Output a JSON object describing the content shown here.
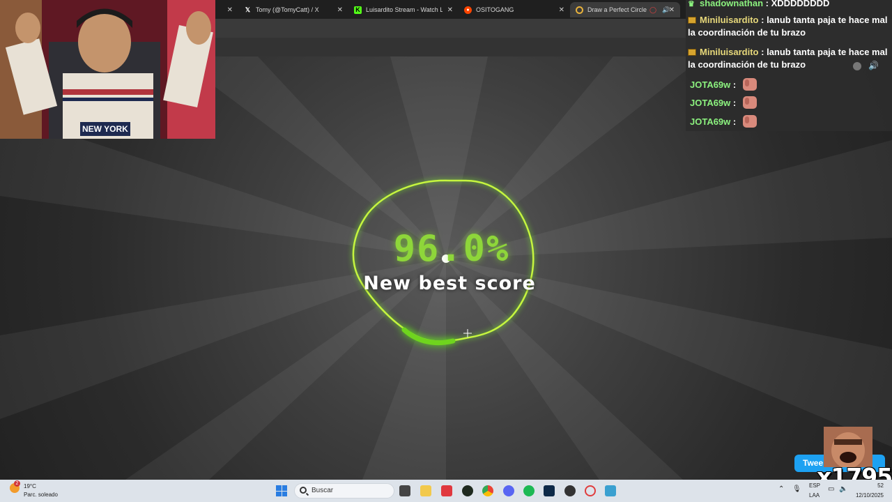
{
  "tabs": [
    {
      "label": "Tomy (@TomyCatt) / X",
      "icon": "x-icon"
    },
    {
      "label": "Luisardito Stream - Watch Live",
      "icon": "kick-icon"
    },
    {
      "label": "OSITOGANG",
      "icon": "reddit-icon"
    },
    {
      "label": "Draw a Perfect Circle",
      "icon": "circle-icon"
    }
  ],
  "game": {
    "score": "96.0%",
    "subtitle": "New best score",
    "accent_color": "#8ed63a"
  },
  "chat": [
    {
      "user": "shadownathan",
      "message": "XDDDDDDDD",
      "badge": "crown-icon"
    },
    {
      "user": "Miniluisardito",
      "message": "lanub tanta paja te hace mal la coordinación de tu brazo",
      "badge": "sub-badge-icon"
    },
    {
      "user": "Miniluisardito",
      "message": "lanub tanta paja te hace mal la coordinación de tu brazo",
      "badge": "sub-badge-icon"
    },
    {
      "user": "JOTA69w",
      "message": "",
      "emote": "thumb-emote"
    },
    {
      "user": "JOTA69w",
      "message": "",
      "emote": "thumb-emote"
    },
    {
      "user": "JOTA69w",
      "message": "",
      "emote": "thumb-emote"
    }
  ],
  "overlay": {
    "tweet_label": "Twee",
    "count": "x1795"
  },
  "webcam": {
    "shirt_text": "NEW YORK"
  },
  "taskbar": {
    "temperature": "19°C",
    "weather_desc": "Parc. soleado",
    "weather_badge": "2",
    "search_placeholder": "Buscar",
    "lang_top": "ESP",
    "lang_bottom": "LAA",
    "time": "52",
    "date": "12/10/2025"
  }
}
